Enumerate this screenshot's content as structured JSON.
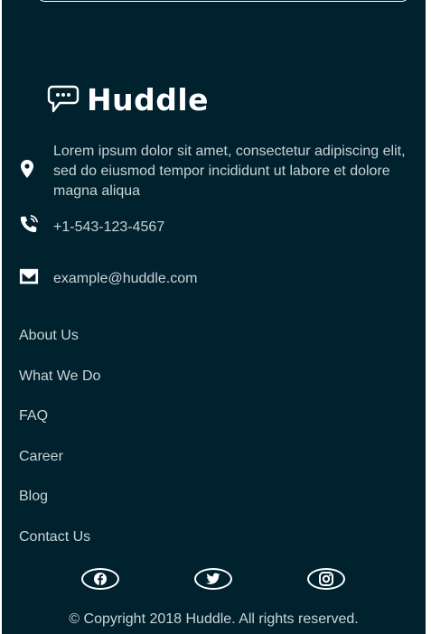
{
  "brand": {
    "name": "Huddle"
  },
  "contact": {
    "address": "Lorem ipsum dolor sit amet, consectetur adipiscing elit, sed do eiusmod tempor incididunt ut labore et dolore magna aliqua",
    "phone": "+1-543-123-4567",
    "email": "example@huddle.com"
  },
  "nav": {
    "items": [
      "About Us",
      "What We Do",
      "FAQ",
      "Career",
      "Blog",
      "Contact Us"
    ]
  },
  "social": {
    "icons": [
      "facebook-icon",
      "twitter-icon",
      "instagram-icon"
    ]
  },
  "copyright": "© Copyright 2018 Huddle. All rights reserved.",
  "colors": {
    "background": "#00222e",
    "text": "#c9d3d6",
    "white": "#ffffff"
  }
}
